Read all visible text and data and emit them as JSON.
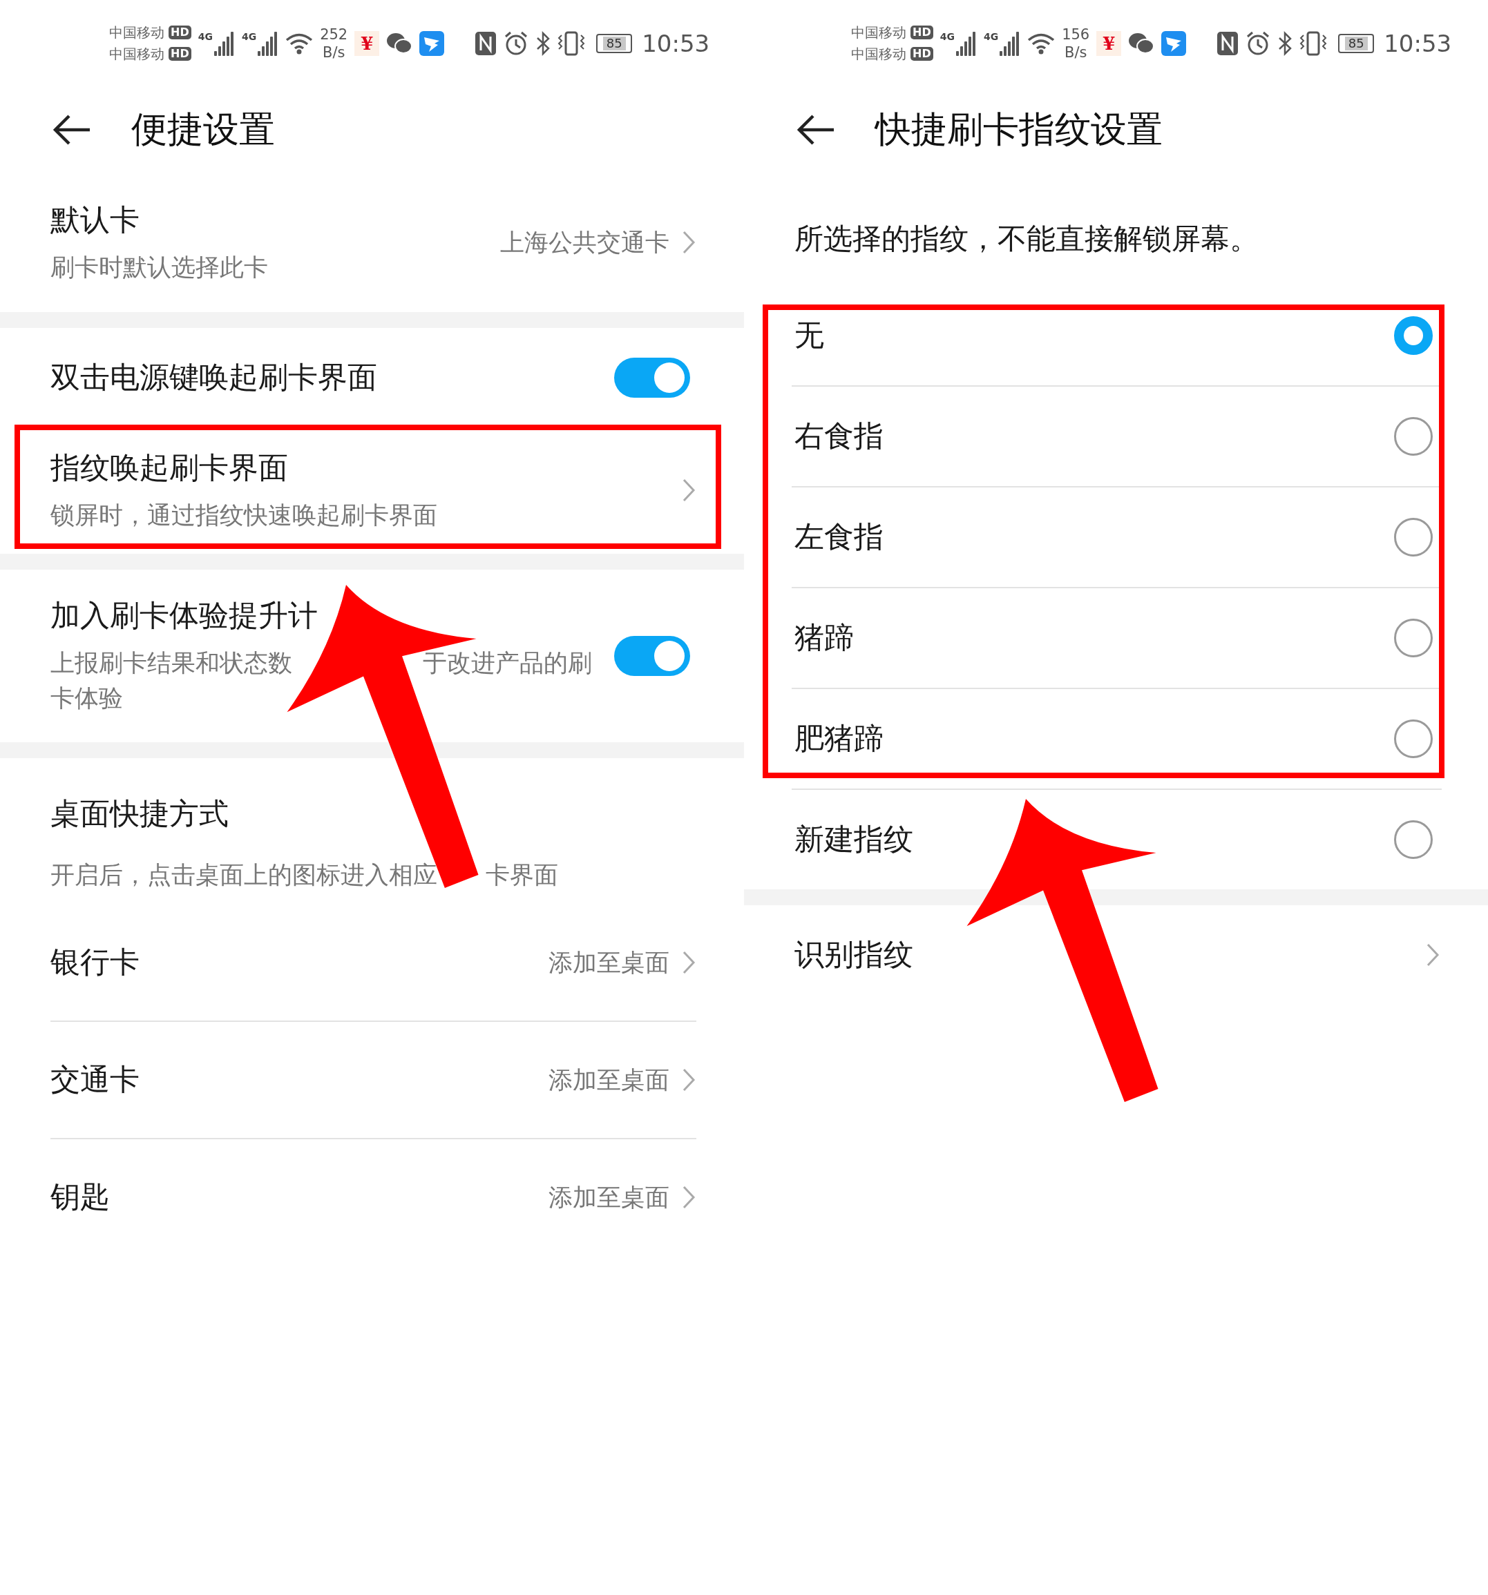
{
  "panels": [
    {
      "status_bar": {
        "carriers": [
          "中国移动",
          "中国移动"
        ],
        "hd": [
          "HD",
          "HD"
        ],
        "networks": [
          "4G",
          "4G"
        ],
        "speed": "252",
        "speed_unit": "B/s",
        "yen": "¥",
        "battery": "85",
        "time": "10:53"
      },
      "header": {
        "title": "便捷设置"
      },
      "groups": [
        {
          "rows": [
            {
              "kind": "nav",
              "title": "默认卡",
              "subtitle": "刷卡时默认选择此卡",
              "value": "上海公共交通卡"
            }
          ]
        },
        {
          "rows": [
            {
              "kind": "toggle",
              "title": "双击电源键唤起刷卡界面",
              "on": true
            },
            {
              "kind": "nav",
              "title": "指纹唤起刷卡界面",
              "subtitle": "锁屏时，通过指纹快速唤起刷卡界面"
            }
          ]
        },
        {
          "rows": [
            {
              "kind": "toggle",
              "title": "加入刷卡体验提升计",
              "subtitle_parts": [
                "上报刷卡结果和状态数",
                "于改进产品的刷",
                "卡体验"
              ],
              "on": true
            }
          ]
        },
        {
          "rows": [
            {
              "kind": "heading",
              "title": "桌面快捷方式",
              "subtitle_parts": [
                "开启后，点击桌面上的图标进入相应",
                "卡界面"
              ]
            },
            {
              "kind": "nav",
              "title": "银行卡",
              "value": "添加至桌面"
            },
            {
              "kind": "nav",
              "title": "交通卡",
              "value": "添加至桌面"
            },
            {
              "kind": "nav",
              "title": "钥匙",
              "value": "添加至桌面"
            }
          ]
        }
      ],
      "annotations": {
        "frame": true,
        "arrow": true
      }
    },
    {
      "status_bar": {
        "carriers": [
          "中国移动",
          "中国移动"
        ],
        "hd": [
          "HD",
          "HD"
        ],
        "networks": [
          "4G",
          "4G"
        ],
        "speed": "156",
        "speed_unit": "B/s",
        "yen": "¥",
        "battery": "85",
        "time": "10:53"
      },
      "header": {
        "title": "快捷刷卡指纹设置"
      },
      "description": "所选择的指纹，不能直接解锁屏幕。",
      "groups": [
        {
          "rows": [
            {
              "kind": "radio",
              "title": "无",
              "selected": true
            },
            {
              "kind": "radio",
              "title": "右食指",
              "selected": false
            },
            {
              "kind": "radio",
              "title": "左食指",
              "selected": false
            },
            {
              "kind": "radio",
              "title": "猪蹄",
              "selected": false
            },
            {
              "kind": "radio",
              "title": "肥猪蹄",
              "selected": false
            },
            {
              "kind": "radio",
              "title": "新建指纹",
              "selected": false
            }
          ]
        },
        {
          "rows": [
            {
              "kind": "nav",
              "title": "识别指纹"
            }
          ]
        }
      ],
      "annotations": {
        "frame": true,
        "arrow": true
      }
    }
  ]
}
